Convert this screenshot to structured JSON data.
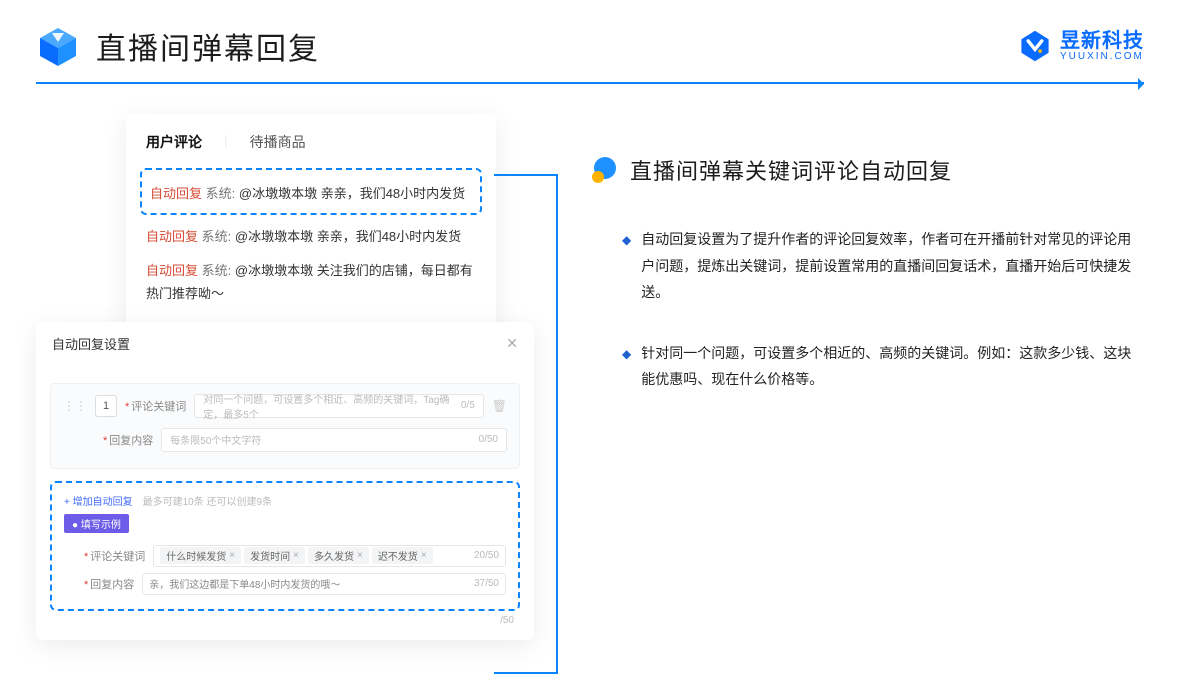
{
  "header": {
    "title": "直播间弹幕回复",
    "logo_text": "昱新科技",
    "logo_sub": "YUUXIN.COM"
  },
  "comments": {
    "tab_active": "用户评论",
    "tab_other": "待播商品",
    "highlighted": {
      "auto": "自动回复",
      "sys": "系统:",
      "text": "@冰墩墩本墩 亲亲，我们48小时内发货"
    },
    "line2": {
      "auto": "自动回复",
      "sys": "系统:",
      "text": "@冰墩墩本墩 亲亲，我们48小时内发货"
    },
    "line3": {
      "auto": "自动回复",
      "sys": "系统:",
      "text": "@冰墩墩本墩 关注我们的店铺，每日都有热门推荐呦～"
    }
  },
  "settings": {
    "title": "自动回复设置",
    "seq": "1",
    "kw_label": "评论关键词",
    "kw_placeholder": "对同一个问题，可设置多个相近、高频的关键词，Tag确定，最多5个",
    "kw_count": "0/5",
    "content_label": "回复内容",
    "content_placeholder": "每条限50个中文字符",
    "content_count": "0/50",
    "add_link": "+ 增加自动回复",
    "add_hint": "最多可建10条 还可以创建9条",
    "example_chip": "● 填写示例",
    "ex_kw_label": "评论关键词",
    "ex_tags": [
      "什么时候发货",
      "发货时间",
      "多久发货",
      "迟不发货"
    ],
    "ex_kw_count": "20/50",
    "ex_content_label": "回复内容",
    "ex_content_text": "亲，我们这边都是下单48小时内发货的哦～",
    "ex_content_count": "37/50",
    "outer_count": "/50"
  },
  "right": {
    "section_title": "直播间弹幕关键词评论自动回复",
    "bullet1": "自动回复设置为了提升作者的评论回复效率，作者可在开播前针对常见的评论用户问题，提炼出关键词，提前设置常用的直播间回复话术，直播开始后可快捷发送。",
    "bullet2": "针对同一个问题，可设置多个相近的、高频的关键词。例如：这款多少钱、这块能优惠吗、现在什么价格等。"
  }
}
